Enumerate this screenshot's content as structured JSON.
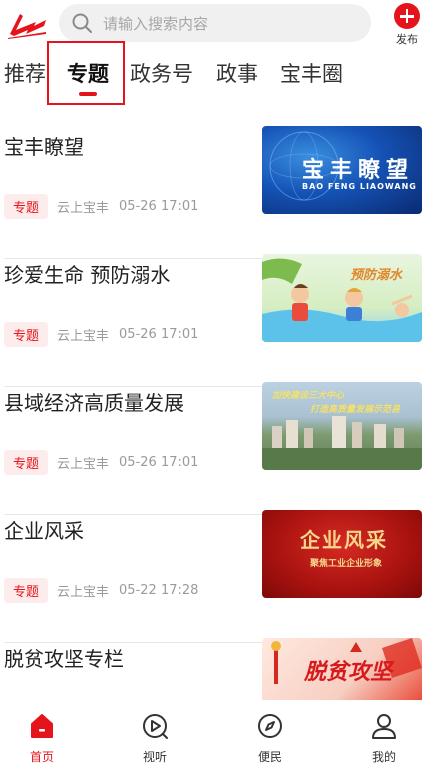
{
  "header": {
    "search_placeholder": "请输入搜索内容",
    "publish_label": "发布"
  },
  "tabs": [
    {
      "label": "推荐"
    },
    {
      "label": "专题"
    },
    {
      "label": "政务号"
    },
    {
      "label": "政事"
    },
    {
      "label": "宝丰圈"
    }
  ],
  "active_tab": "专题",
  "articles": [
    {
      "title": "宝丰瞭望",
      "tag": "专题",
      "source": "云上宝丰",
      "time": "05-26 17:01",
      "thumb_title": "宝丰瞭望",
      "thumb_subtitle": "BAO FENG LIAOWANG"
    },
    {
      "title": "珍爱生命 预防溺水",
      "tag": "专题",
      "source": "云上宝丰",
      "time": "05-26 17:01",
      "thumb_title": "预防溺水"
    },
    {
      "title": "县域经济高质量发展",
      "tag": "专题",
      "source": "云上宝丰",
      "time": "05-26 17:01",
      "thumb_title": "加快建设三大中心",
      "thumb_subtitle": "打造高质量发展示范县"
    },
    {
      "title": "企业风采",
      "tag": "专题",
      "source": "云上宝丰",
      "time": "05-22 17:28",
      "thumb_title": "企业风采",
      "thumb_subtitle": "聚焦工业企业形象"
    },
    {
      "title": "脱贫攻坚专栏",
      "thumb_title": "脱贫攻坚"
    }
  ],
  "bottom_nav": [
    {
      "label": "首页",
      "icon": "home-icon",
      "active": true
    },
    {
      "label": "视听",
      "icon": "play-icon"
    },
    {
      "label": "便民",
      "icon": "compass-icon"
    },
    {
      "label": "我的",
      "icon": "user-icon"
    }
  ],
  "colors": {
    "accent": "#e5141c",
    "tag_bg": "#fdecec",
    "meta_text": "#9a9a9a"
  }
}
